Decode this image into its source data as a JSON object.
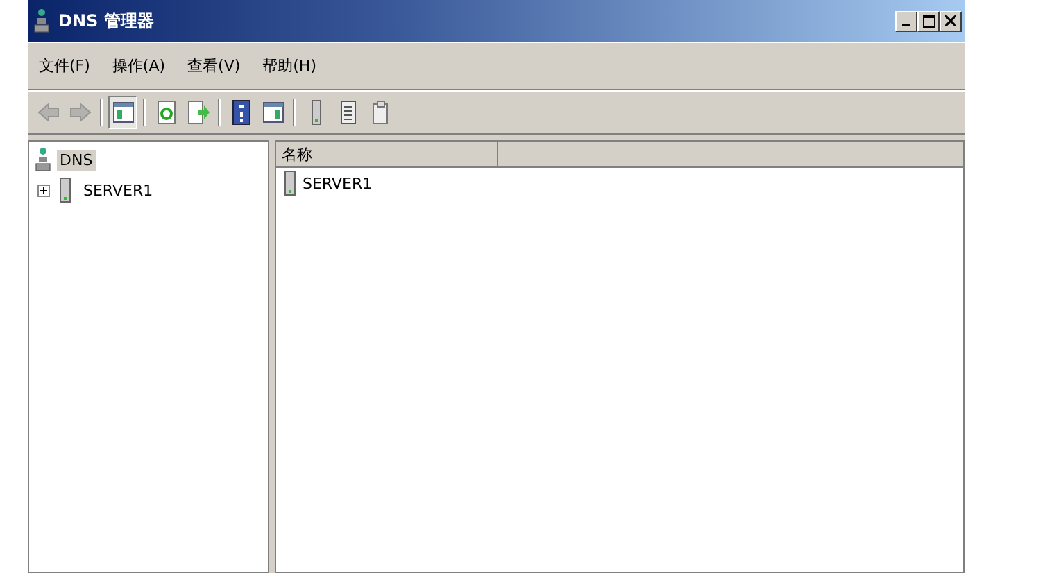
{
  "window": {
    "title": "DNS 管理器"
  },
  "menu": [
    "文件(F)",
    "操作(A)",
    "查看(V)",
    "帮助(H)"
  ],
  "toolbar": [
    {
      "kind": "back",
      "disabled": true,
      "selected": false
    },
    {
      "kind": "forward",
      "disabled": true,
      "selected": false
    },
    {
      "kind": "sep"
    },
    {
      "kind": "tree",
      "disabled": false,
      "selected": true
    },
    {
      "kind": "sep"
    },
    {
      "kind": "refresh",
      "disabled": false,
      "selected": false
    },
    {
      "kind": "export",
      "disabled": false,
      "selected": false
    },
    {
      "kind": "sep"
    },
    {
      "kind": "help",
      "disabled": false,
      "selected": false
    },
    {
      "kind": "pane",
      "disabled": false,
      "selected": false
    },
    {
      "kind": "sep"
    },
    {
      "kind": "server",
      "disabled": false,
      "selected": false
    },
    {
      "kind": "list",
      "disabled": false,
      "selected": false
    },
    {
      "kind": "copy",
      "disabled": false,
      "selected": false
    }
  ],
  "tree": {
    "label": "DNS",
    "selected": true,
    "children": [
      {
        "label": "SERVER1",
        "expanded": false,
        "selected": false
      }
    ]
  },
  "table": {
    "columns": [
      "名称"
    ],
    "rows": [
      {
        "name": "SERVER1"
      }
    ]
  }
}
